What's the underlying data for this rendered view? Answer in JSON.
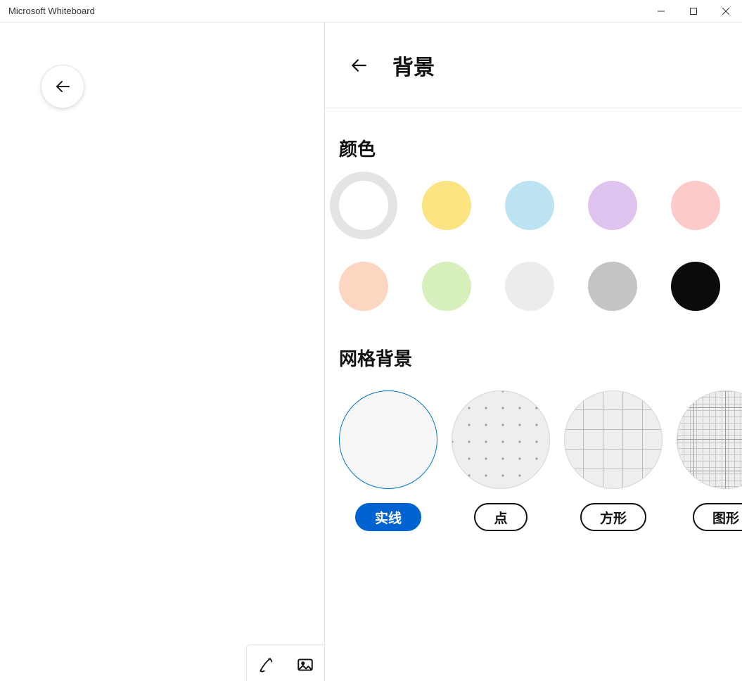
{
  "window": {
    "title": "Microsoft Whiteboard"
  },
  "panel": {
    "title": "背景",
    "sections": {
      "color_title": "颜色",
      "grid_title": "网格背景"
    }
  },
  "colors": [
    {
      "name": "white",
      "hex": "#ffffff",
      "selected": true
    },
    {
      "name": "yellow",
      "hex": "#fbe481",
      "selected": false
    },
    {
      "name": "blue",
      "hex": "#bce3f2",
      "selected": false
    },
    {
      "name": "purple",
      "hex": "#dfc3ef",
      "selected": false
    },
    {
      "name": "pink",
      "hex": "#fdcaca",
      "selected": false
    },
    {
      "name": "peach",
      "hex": "#fdd6c1",
      "selected": false
    },
    {
      "name": "green",
      "hex": "#d7f0bb",
      "selected": false
    },
    {
      "name": "light-gray",
      "hex": "#ececec",
      "selected": false
    },
    {
      "name": "gray",
      "hex": "#c4c4c4",
      "selected": false
    },
    {
      "name": "black",
      "hex": "#0b0b0b",
      "selected": false
    }
  ],
  "grids": [
    {
      "key": "solid",
      "label": "实线",
      "selected": true
    },
    {
      "key": "dot",
      "label": "点",
      "selected": false
    },
    {
      "key": "square",
      "label": "方形",
      "selected": false
    },
    {
      "key": "graph",
      "label": "图形",
      "selected": false
    }
  ],
  "icons": {
    "back": "arrow-left",
    "pen": "pen",
    "image": "image"
  }
}
